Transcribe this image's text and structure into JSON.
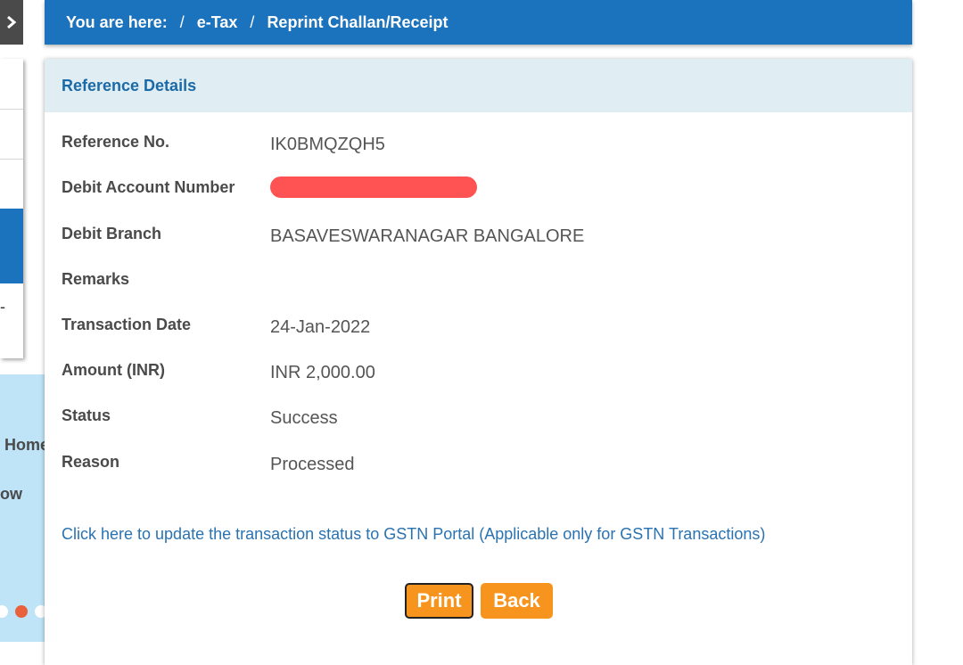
{
  "breadcrumb": {
    "label": "You are here:",
    "separator": "/",
    "items": [
      "e-Tax",
      "Reprint Challan/Receipt"
    ]
  },
  "sidebar": {
    "banner_text_1": "Home",
    "banner_text_2": "ow",
    "dash": "-"
  },
  "section": {
    "title": "Reference Details"
  },
  "details": {
    "reference_no": {
      "label": "Reference No.",
      "value": "IK0BMQZQH5"
    },
    "debit_account": {
      "label": "Debit Account Number",
      "value": ""
    },
    "debit_branch": {
      "label": "Debit Branch",
      "value": "BASAVESWARANAGAR BANGALORE"
    },
    "remarks": {
      "label": "Remarks",
      "value": ""
    },
    "transaction_date": {
      "label": "Transaction Date",
      "value": "24-Jan-2022"
    },
    "amount": {
      "label": "Amount (INR)",
      "value": "INR 2,000.00"
    },
    "status": {
      "label": "Status",
      "value": "Success"
    },
    "reason": {
      "label": "Reason",
      "value": "Processed"
    }
  },
  "gstn_link": "Click here to update the transaction status to GSTN Portal (Applicable only for GSTN Transactions)",
  "buttons": {
    "print": "Print",
    "back": "Back"
  },
  "colors": {
    "header_blue": "#1b72bd",
    "button_orange": "#f7941d",
    "redaction_red": "#ff5252",
    "carousel_active_dot": "#e8603c"
  },
  "icons": {
    "sidebar_toggle": "chevron-right-icon",
    "carousel_next": "chevron-right-icon"
  }
}
